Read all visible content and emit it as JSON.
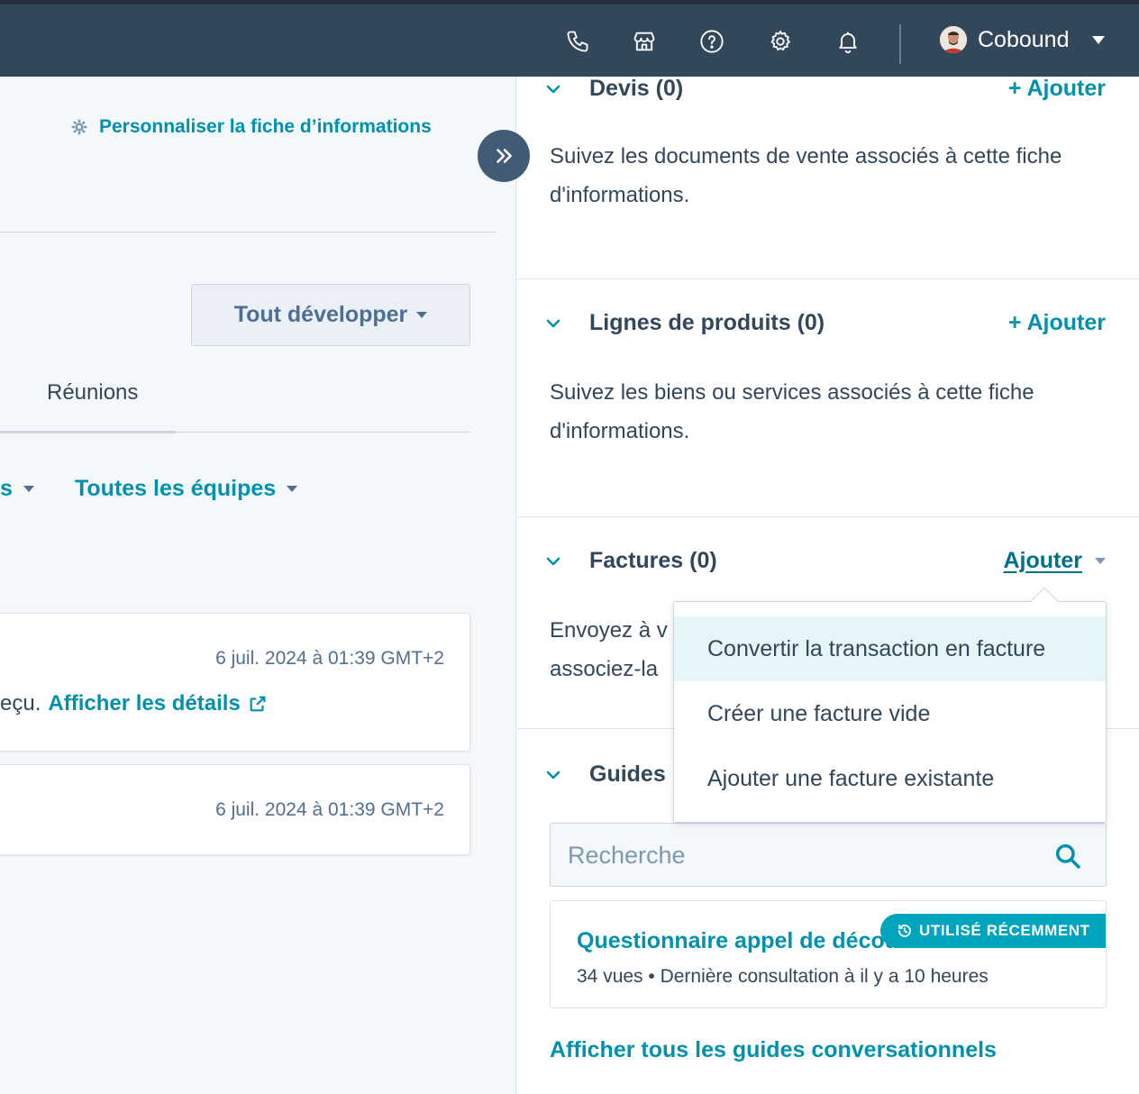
{
  "topbar": {
    "icons": [
      "phone-icon",
      "marketplace-icon",
      "help-icon",
      "settings-icon",
      "notifications-icon"
    ],
    "account_name": "Cobound"
  },
  "left": {
    "customize_label": "Personnaliser la fiche d’informations",
    "expand_all_label": "Tout développer",
    "tab_meetings": "Réunions",
    "filter_partial": "s",
    "filter_teams": "Toutes les équipes",
    "cards": [
      {
        "timestamp": "6 juil. 2024 à 01:39 GMT+2",
        "text_partial": "eçu.",
        "link": "Afficher les détails"
      },
      {
        "timestamp": "6 juil. 2024 à 01:39 GMT+2"
      }
    ]
  },
  "right": {
    "quotes": {
      "title": "Devis (0)",
      "add": "+ Ajouter",
      "desc": "Suivez les documents de vente associés à cette fiche d'informations."
    },
    "line_items": {
      "title": "Lignes de produits (0)",
      "add": "+ Ajouter",
      "desc": "Suivez les biens ou services associés à cette fiche d'informations."
    },
    "invoices": {
      "title": "Factures (0)",
      "add": "Ajouter",
      "desc_line1": "Envoyez à v",
      "desc_line2": "associez-la"
    },
    "guides": {
      "title": "Guides",
      "search_placeholder": "Recherche",
      "item_title": "Questionnaire appel de découverte",
      "item_meta": "34 vues • Dernière consultation à il y a 10 heures",
      "badge": "UTILISÉ RÉCEMMENT",
      "view_all": "Afficher tous les guides conversationnels"
    }
  },
  "menu": {
    "items": [
      "Convertir la transaction en facture",
      "Créer une facture vide",
      "Ajouter une facture existante"
    ]
  },
  "colors": {
    "nav": "#33475b",
    "accent": "#0091ae",
    "badge": "#00a4bd",
    "highlight": "#e5f5f8"
  }
}
